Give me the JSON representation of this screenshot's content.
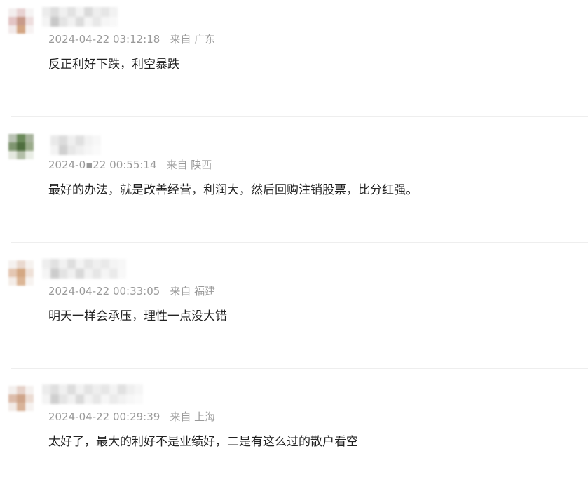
{
  "comments": [
    {
      "timestamp": "2024-04-22 03:12:18",
      "location": "来自 广东",
      "text": "反正利好下跌，利空暴跌",
      "avatar_colors": [
        "#f3eeee",
        "#e8d2d2",
        "#f6f4f4",
        "#e3c5c5",
        "#c89a8a",
        "#eedede",
        "#f2eaea",
        "#d4a684",
        "#f7f2f2"
      ]
    },
    {
      "timestamp": "2024-0▪22 00:55:14",
      "location": "来自 陕西",
      "text": "最好的办法，就是改善经营，利润大，然后回购注销股票，比分红强。",
      "avatar_colors": [
        "#b9c2b3",
        "#6b8a5a",
        "#a7b39c",
        "#7f9570",
        "#4f6e3f",
        "#9aab8b",
        "#e4e8df",
        "#b3bfa8",
        "#eaeee6"
      ]
    },
    {
      "timestamp": "2024-04-22 00:33:05",
      "location": "来自 福建",
      "text": "明天一样会承压，理性一点没大错",
      "avatar_colors": [
        "#f5f1ef",
        "#ead9cf",
        "#f6f2ef",
        "#e4c7b3",
        "#d4a883",
        "#efe1d8",
        "#f4ede8",
        "#dcb696",
        "#f7f3f0"
      ]
    },
    {
      "timestamp": "2024-04-22 00:29:39",
      "location": "来自 上海",
      "text": "太好了，最大的利好不是业绩好，二是有这么过的散户看空",
      "avatar_colors": [
        "#f3efed",
        "#e6d2c9",
        "#f5f1ef",
        "#dcbcaa",
        "#cfa58a",
        "#ecdcd3",
        "#f2ebe7",
        "#d8b399",
        "#f6f2f0"
      ]
    }
  ]
}
